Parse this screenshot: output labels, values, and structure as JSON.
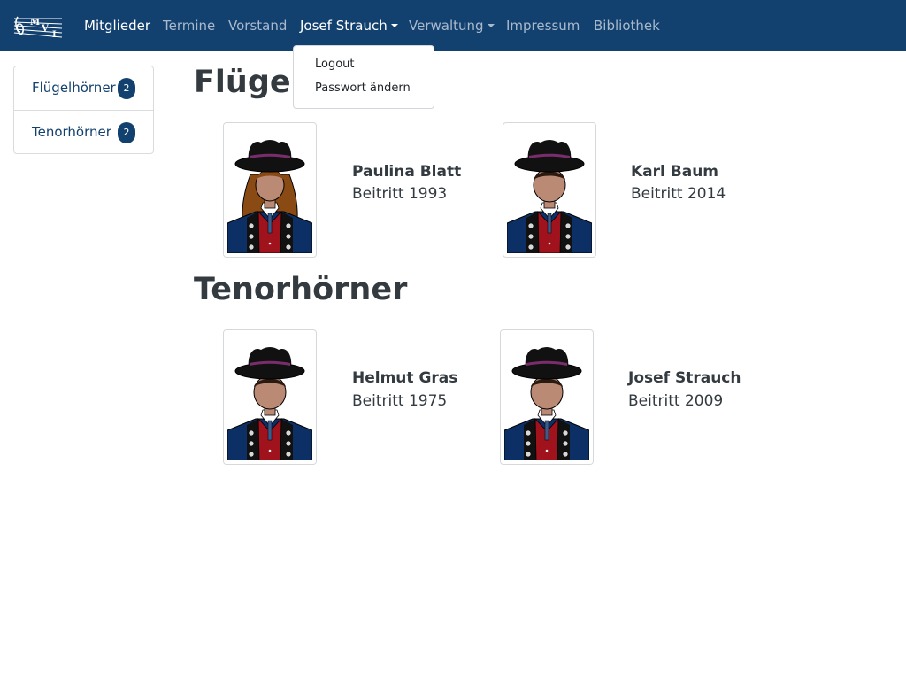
{
  "nav": {
    "items": [
      {
        "label": "Mitglieder"
      },
      {
        "label": "Termine"
      },
      {
        "label": "Vorstand"
      },
      {
        "label": "Josef Strauch"
      },
      {
        "label": "Verwaltung"
      },
      {
        "label": "Impressum"
      },
      {
        "label": "Bibliothek"
      }
    ],
    "active_item": "Mitglieder",
    "open_dropdown": "Josef Strauch"
  },
  "user_menu": {
    "items": [
      {
        "label": "Logout"
      },
      {
        "label": "Passwort ändern"
      }
    ]
  },
  "sidebar": {
    "items": [
      {
        "label": "Flügelhörner",
        "count": "2"
      },
      {
        "label": "Tenorhörner",
        "count": "2"
      }
    ]
  },
  "sections": [
    {
      "title": "Flügelhörner",
      "members": [
        {
          "name": "Paulina Blatt",
          "since": "Beitritt 1993",
          "avatar": "female-avatar"
        },
        {
          "name": "Karl Baum",
          "since": "Beitritt 2014",
          "avatar": "male-avatar"
        }
      ]
    },
    {
      "title": "Tenorhörner",
      "members": [
        {
          "name": "Helmut Gras",
          "since": "Beitritt 1975",
          "avatar": "male-avatar"
        },
        {
          "name": "Josef Strauch",
          "since": "Beitritt 2009",
          "avatar": "male-avatar"
        }
      ]
    }
  ],
  "colors": {
    "navbar": "#13416f",
    "nav_link": "#a9b9cc",
    "nav_active": "#ffffff",
    "badge": "#13416f",
    "vest": "#a0121c",
    "jacket": "#0c2f66",
    "hat": "#111111",
    "hat_band": "#7a2d6c",
    "skin": "#bb8a74",
    "hair": "#8a4a14"
  }
}
